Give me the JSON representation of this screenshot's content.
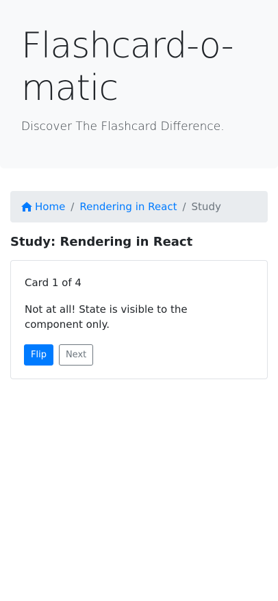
{
  "header": {
    "title": "Flashcard-o-matic",
    "subtitle": "Discover The Flashcard Difference."
  },
  "breadcrumb": {
    "home_label": "Home",
    "deck_label": "Rendering in React",
    "current_label": "Study",
    "separator": "/"
  },
  "page": {
    "heading": "Study: Rendering in React"
  },
  "card": {
    "counter": "Card 1 of 4",
    "text": "Not at all! State is visible to the component only.",
    "flip_label": "Flip",
    "next_label": "Next"
  },
  "colors": {
    "primary": "#007bff",
    "secondary": "#6c757d",
    "jumbotron_bg": "#f8f9fa",
    "breadcrumb_bg": "#e9ecef"
  },
  "icons": {
    "home": "home-icon"
  }
}
